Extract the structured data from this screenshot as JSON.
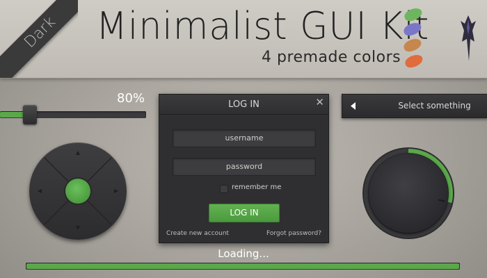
{
  "header": {
    "ribbon_label": "Dark",
    "title": "Minimalist GUI Kit",
    "subtitle": "4 premade colors",
    "color_swatches": [
      "#6db55e",
      "#7a77c8",
      "#c7864e",
      "#e06b3c"
    ],
    "logo_icon": "dragon-logo-icon"
  },
  "slider": {
    "value_label": "80%",
    "value": 0.2,
    "accent": "#5aa84a"
  },
  "dpad": {
    "center_color": "#5aa84a",
    "arrows": [
      "arrow-up-icon",
      "arrow-right-icon",
      "arrow-down-icon",
      "arrow-left-icon"
    ]
  },
  "login": {
    "title": "LOG IN",
    "close_icon": "close-icon",
    "username_placeholder": "username",
    "password_placeholder": "password",
    "remember_label": "remember me",
    "submit_label": "LOG IN",
    "create_link": "Create new account",
    "forgot_link": "Forgot password?"
  },
  "select": {
    "label": "Select something",
    "arrow_icon": "chevron-left-icon"
  },
  "knob": {
    "value": 0.3,
    "accent": "#5aa84a"
  },
  "loading": {
    "label": "Loading...",
    "progress": 1.0
  },
  "colors": {
    "accent": "#5aa84a",
    "panel": "#2f2f31"
  }
}
